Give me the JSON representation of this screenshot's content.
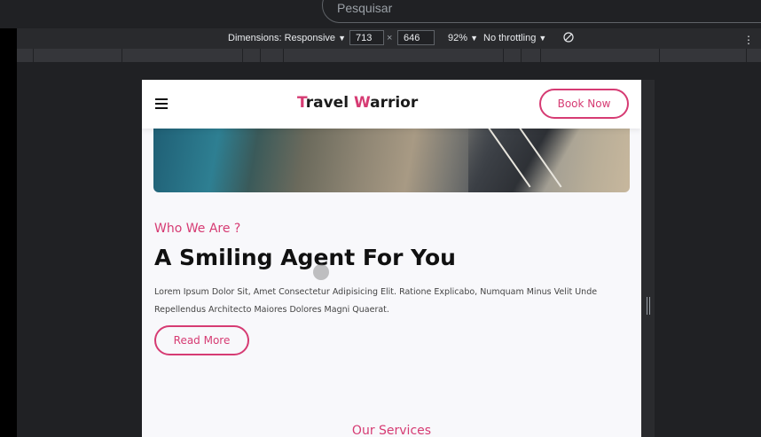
{
  "browser": {
    "search_placeholder": "Pesquisar"
  },
  "devtools": {
    "dimensions_label": "Dimensions: Responsive",
    "width_value": "713",
    "times_sign": "×",
    "height_value": "646",
    "zoom_label": "92%",
    "throttling_label": "No throttling",
    "dropdown_glyph": "▼",
    "rotate_icon": "rotate-icon",
    "more_icon": "⋮"
  },
  "site": {
    "brand_first_letter": "T",
    "brand_part1": "ravel ",
    "brand_second_letter": "W",
    "brand_part2": "arrior",
    "book_now": "Book Now",
    "eyebrow": "Who We Are ?",
    "headline": "A Smiling Agent For You",
    "body": "Lorem Ipsum Dolor Sit, Amet Consectetur Adipisicing Elit. Ratione Explicabo, Numquam Minus Velit Unde Repellendus Architecto Maiores Dolores Magni Quaerat.",
    "read_more": "Read More",
    "services_title": "Our Services",
    "accent_color": "#d63b73"
  }
}
